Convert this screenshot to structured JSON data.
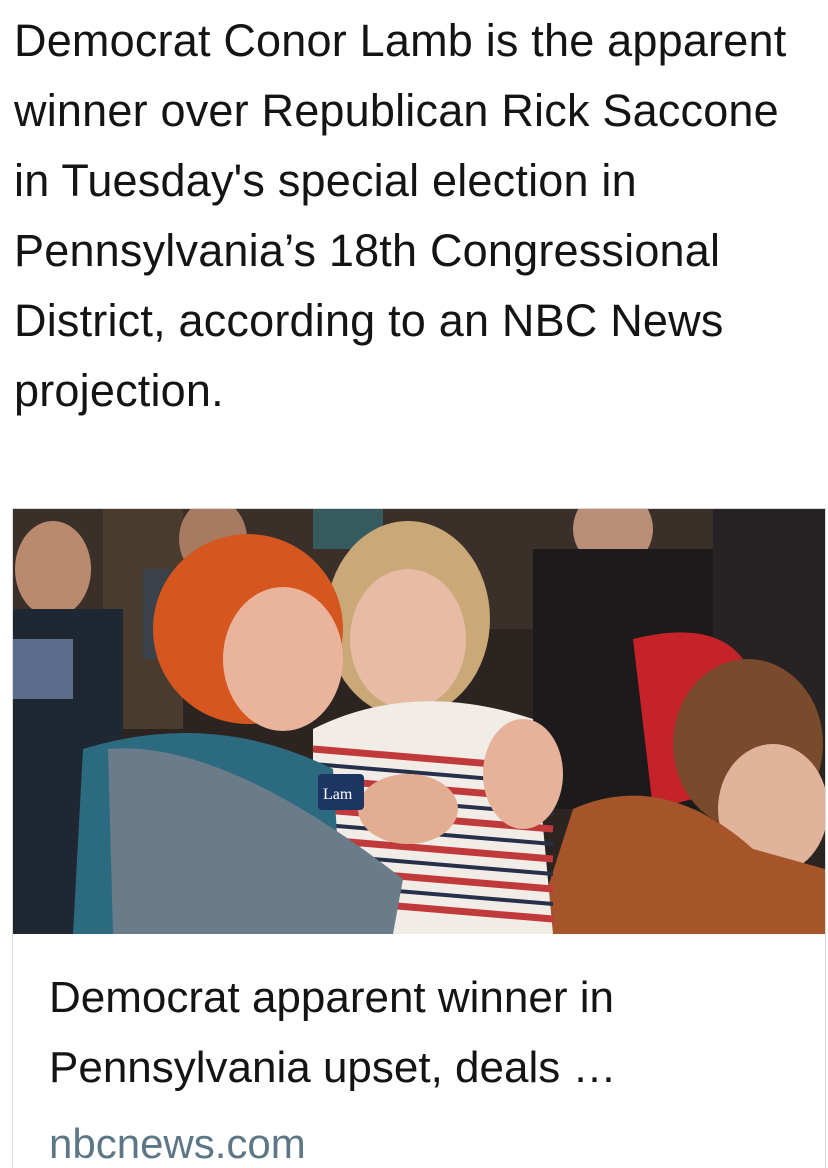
{
  "post": {
    "text": "Democrat Conor Lamb is the apparent winner over Republican Rick Saccone in Tuesday's special election in Pennsylvania’s 18th Congressional District, according to an NBC News projection."
  },
  "link_preview": {
    "image": {
      "badge_text": "Lam"
    },
    "title": "Democrat apparent winner in Pennsylvania upset, deals …",
    "domain": "nbcnews.com"
  }
}
